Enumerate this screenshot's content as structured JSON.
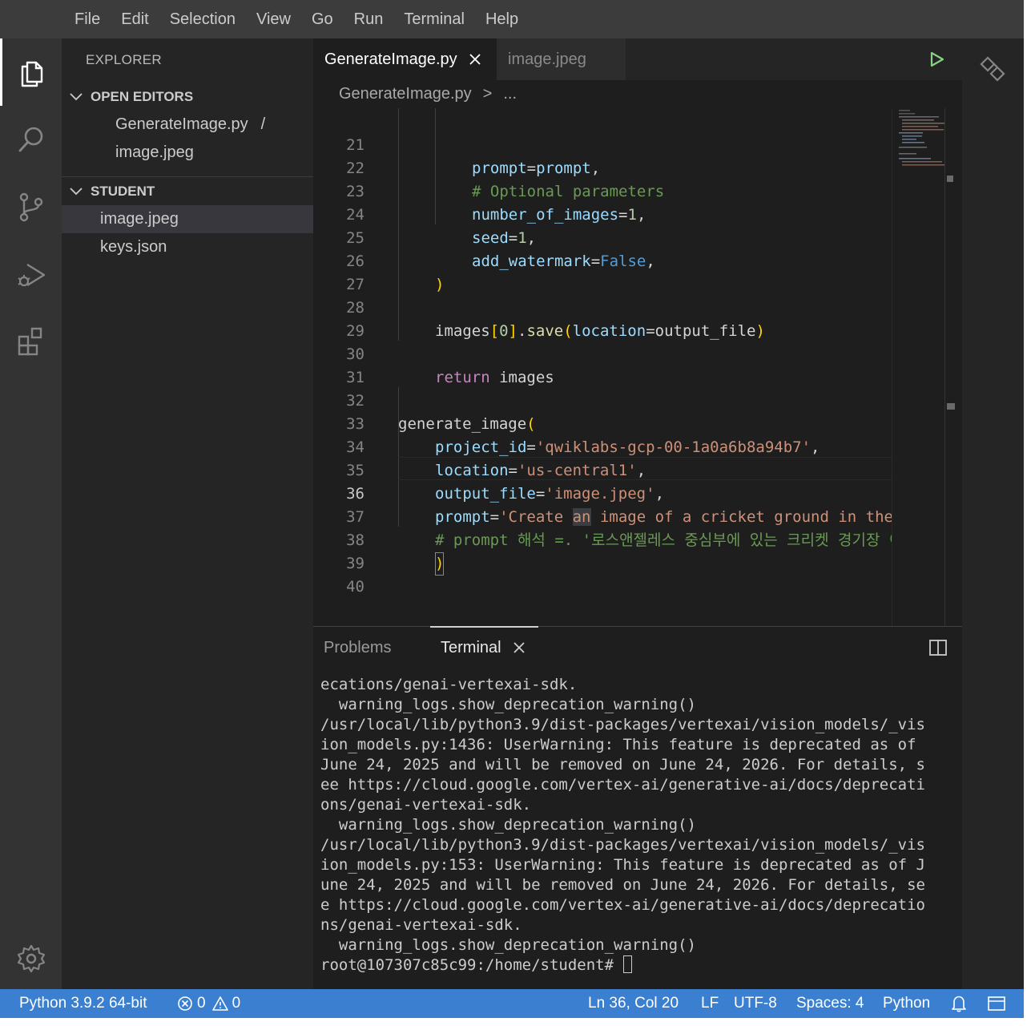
{
  "menu": [
    "File",
    "Edit",
    "Selection",
    "View",
    "Go",
    "Run",
    "Terminal",
    "Help"
  ],
  "sidebar": {
    "title": "EXPLORER",
    "open_editors": {
      "label": "OPEN EDITORS",
      "items": [
        {
          "name": "GenerateImage.py",
          "suffix": "/"
        },
        {
          "name": "image.jpeg",
          "suffix": ""
        }
      ]
    },
    "student": {
      "label": "STUDENT",
      "items": [
        "image.jpeg",
        "keys.json"
      ]
    }
  },
  "tabs": [
    {
      "label": "GenerateImage.py",
      "active": true
    },
    {
      "label": "image.jpeg",
      "active": false
    }
  ],
  "breadcrumb": {
    "file": "GenerateImage.py",
    "separator": ">",
    "rest": "..."
  },
  "code": {
    "line_numbers": [
      "21",
      "22",
      "23",
      "24",
      "25",
      "26",
      "27",
      "28",
      "29",
      "30",
      "31",
      "32",
      "33",
      "34",
      "35",
      "36",
      "37",
      "38",
      "39",
      "40"
    ],
    "current_line": "36",
    "l21": {
      "var": "prompt",
      "eq": "=",
      "val": "prompt",
      "comma": ","
    },
    "l22": "# Optional parameters",
    "l23": {
      "var": "number_of_images",
      "eq": "=",
      "val": "1",
      "comma": ","
    },
    "l24": {
      "var": "seed",
      "eq": "=",
      "val": "1",
      "comma": ","
    },
    "l25": {
      "var": "add_watermark",
      "eq": "=",
      "val": "False",
      "comma": ","
    },
    "l26": ")",
    "l28": {
      "a": "images",
      "b": "[",
      "c": "0",
      "d": "].",
      "e": "save",
      "f": "(",
      "g": "location",
      "h": "=output_file",
      "i": ")"
    },
    "l30": {
      "kw": "return",
      "rest": " images"
    },
    "l32": {
      "fn": "generate_image",
      "paren": "("
    },
    "l33": {
      "var": "project_id",
      "eq": "=",
      "val": "'qwiklabs-gcp-00-1a0a6b8a94b7'",
      "comma": ","
    },
    "l34": {
      "var": "location",
      "eq": "=",
      "val": "'us-central1'",
      "comma": ","
    },
    "l35": {
      "var": "output_file",
      "eq": "=",
      "val": "'image.jpeg'",
      "comma": ","
    },
    "l36": {
      "var": "prompt",
      "eq": "=",
      "val1": "'Create ",
      "hl": "an",
      "val2": " image of a cricket ground in the"
    },
    "l37": "# prompt 해석 =. '로스앤젤레스 중심부에 있는 크리켓 경기장 이",
    "l38": ")"
  },
  "panel": {
    "tabs": [
      "Problems",
      "Terminal"
    ],
    "active": "Terminal",
    "terminal_lines": [
      "ecations/genai-vertexai-sdk.",
      "  warning_logs.show_deprecation_warning()",
      "/usr/local/lib/python3.9/dist-packages/vertexai/vision_models/_vis",
      "ion_models.py:1436: UserWarning: This feature is deprecated as of",
      "June 24, 2025 and will be removed on June 24, 2026. For details, s",
      "ee https://cloud.google.com/vertex-ai/generative-ai/docs/deprecati",
      "ons/genai-vertexai-sdk.",
      "  warning_logs.show_deprecation_warning()",
      "/usr/local/lib/python3.9/dist-packages/vertexai/vision_models/_vis",
      "ion_models.py:153: UserWarning: This feature is deprecated as of J",
      "une 24, 2025 and will be removed on June 24, 2026. For details, se",
      "e https://cloud.google.com/vertex-ai/generative-ai/docs/deprecatio",
      "ns/genai-vertexai-sdk.",
      "  warning_logs.show_deprecation_warning()"
    ],
    "prompt": "root@107307c85c99:/home/student# "
  },
  "status": {
    "interpreter": "Python 3.9.2 64-bit",
    "errors": "0",
    "warnings": "0",
    "position": "Ln 36, Col 20",
    "eol": "LF",
    "encoding": "UTF-8",
    "spaces": "Spaces: 4",
    "language": "Python"
  },
  "colors": {
    "status_bar": "#3b7fd0",
    "editor_bg": "#1e1e1e",
    "sidebar_bg": "#252526",
    "run_icon": "#89d185"
  },
  "icons": [
    "files-icon",
    "search-icon",
    "source-control-icon",
    "run-debug-icon",
    "extensions-icon",
    "gear-icon",
    "play-icon",
    "close-icon",
    "split-panel-icon",
    "remote-icon",
    "bell-icon",
    "layout-icon",
    "error-icon",
    "warning-icon",
    "chevron-down-icon"
  ]
}
